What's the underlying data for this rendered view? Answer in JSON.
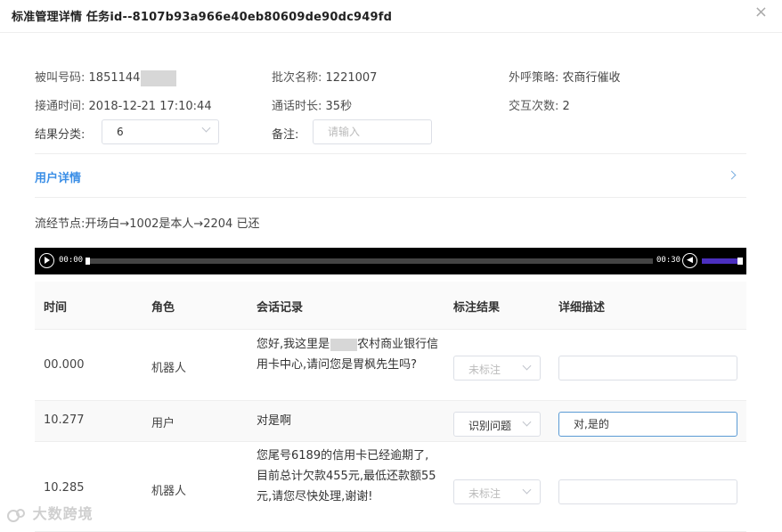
{
  "dialog": {
    "title": "标准管理详情 任务id--8107b93a966e40eb80609de90dc949fd",
    "close_icon": "×"
  },
  "info": {
    "called_number_label": "被叫号码:",
    "called_number_value": "1851144",
    "batch_label": "批次名称:",
    "batch_value": "1221007",
    "strategy_label": "外呼策略:",
    "strategy_value": "农商行催收",
    "connect_time_label": "接通时间:",
    "connect_time_value": "2018-12-21 17:10:44",
    "duration_label": "通话时长:",
    "duration_value": "35秒",
    "interactions_label": "交互次数:",
    "interactions_value": "2",
    "result_label": "结果分类:",
    "result_value": "6",
    "remark_label": "备注:",
    "remark_placeholder": "请输入"
  },
  "user_detail_link": "用户详情",
  "flow": "流经节点:开场白→1002是本人→2204 已还",
  "player": {
    "current_time": "00:00",
    "total_time": "00:30",
    "progress": 0,
    "volume": 1.0
  },
  "table": {
    "headers": [
      "时间",
      "角色",
      "会话记录",
      "标注结果",
      "详细描述"
    ],
    "rows": [
      {
        "time": "00.000",
        "role": "机器人",
        "msg_a": "您好,我这里是",
        "msg_b": "农村商业银行信用卡中心,请问您是胃枫先生吗?",
        "mark": "未标注",
        "desc": ""
      },
      {
        "time": "10.277",
        "role": "用户",
        "msg_a": "对是啊",
        "msg_b": "",
        "mark": "识别问题",
        "desc": "对,是的"
      },
      {
        "time": "10.285",
        "role": "机器人",
        "msg_a": "您尾号6189的信用卡已经逾期了,目前总计欠款455元,最低还款额55元,请您尽快处理,谢谢!",
        "msg_b": "",
        "mark": "未标注",
        "desc": ""
      }
    ]
  },
  "watermark": "大数跨境",
  "colors": {
    "link": "#3a8ee6",
    "volume": "#4b2fbf",
    "focus": "#5b9bd5"
  }
}
